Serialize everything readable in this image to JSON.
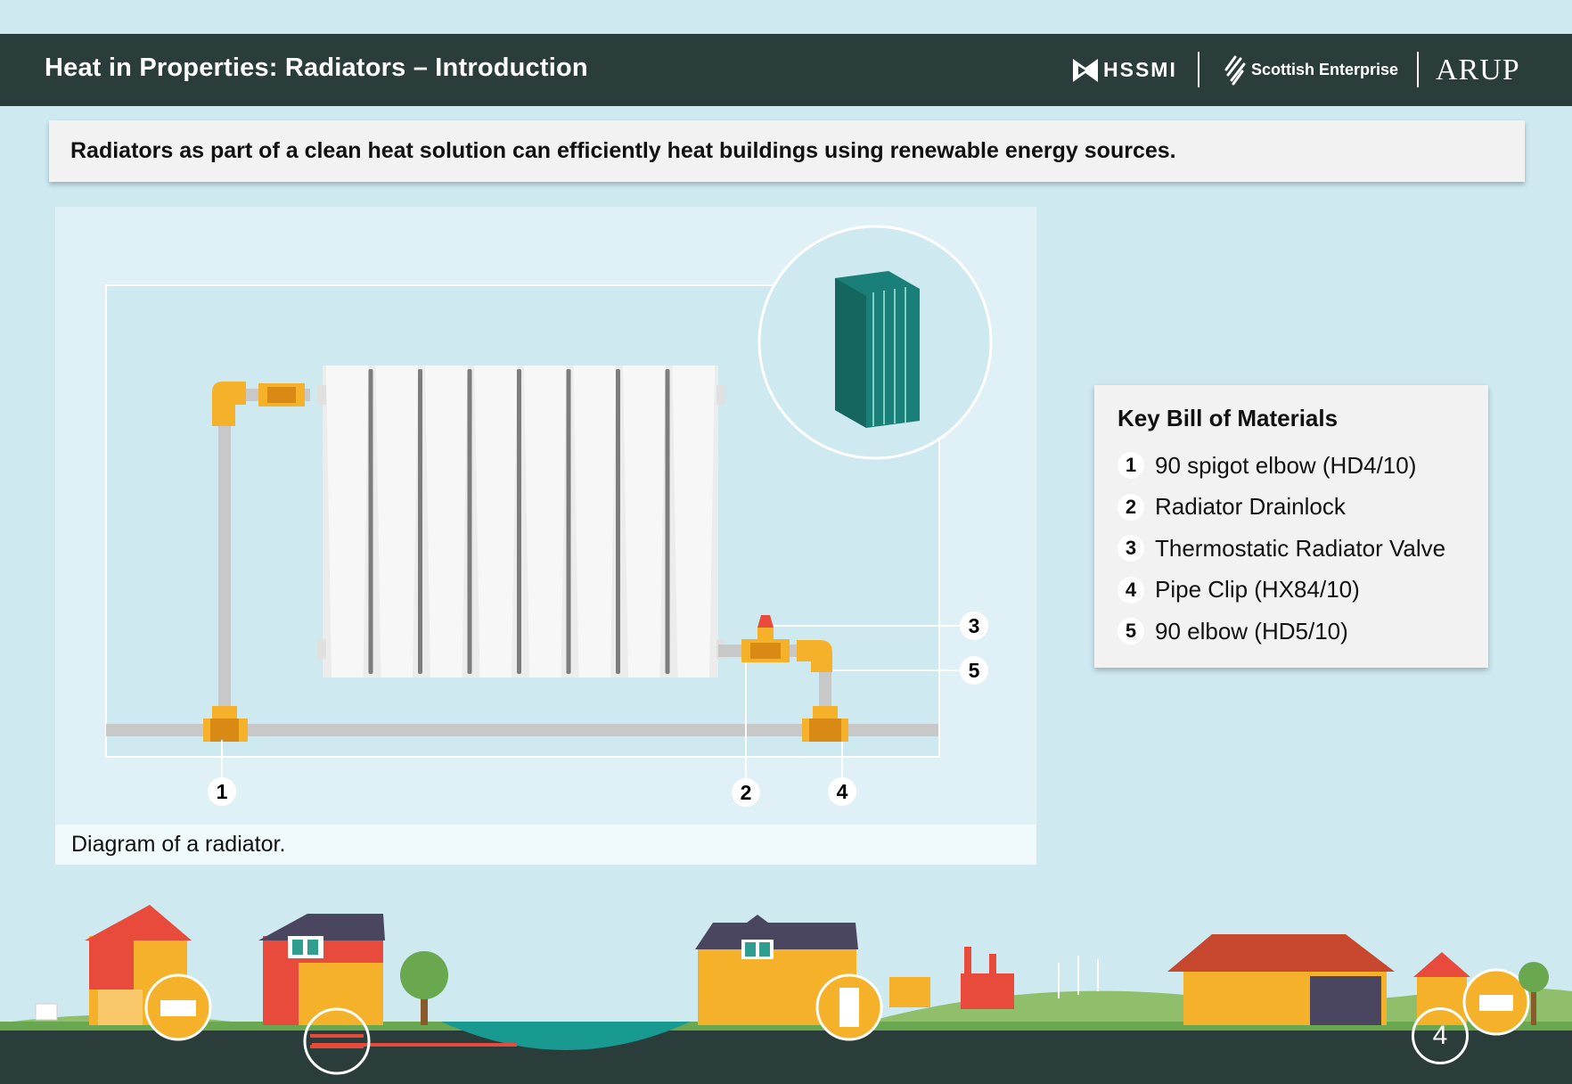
{
  "header": {
    "title": "Heat in Properties: Radiators – Introduction",
    "logos": {
      "hssmi": "HSSMI",
      "scottish_enterprise": "Scottish Enterprise",
      "arup": "ARUP"
    }
  },
  "banner": {
    "text": "Radiators as part of a clean heat solution can efficiently heat buildings using renewable energy sources."
  },
  "diagram": {
    "caption": "Diagram of a radiator.",
    "callouts": [
      "1",
      "2",
      "3",
      "4",
      "5"
    ]
  },
  "bill_of_materials": {
    "title": "Key Bill of Materials",
    "items": [
      {
        "num": "1",
        "label": "90 spigot elbow (HD4/10)"
      },
      {
        "num": "2",
        "label": "Radiator Drainlock"
      },
      {
        "num": "3",
        "label": "Thermostatic Radiator Valve"
      },
      {
        "num": "4",
        "label": "Pipe Clip (HX84/10)"
      },
      {
        "num": "5",
        "label": "90 elbow (HD5/10)"
      }
    ]
  },
  "page_number": "4",
  "colors": {
    "header_bg": "#2b3d3b",
    "page_bg": "#cfe9f1",
    "fitting_yellow": "#f5b12a",
    "pipe_grey": "#c8c8c8",
    "valve_red": "#e84a3c",
    "teal": "#1a7f78"
  }
}
